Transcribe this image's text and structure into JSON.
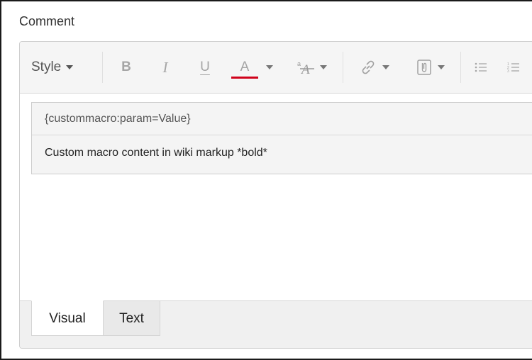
{
  "field": {
    "label": "Comment"
  },
  "toolbar": {
    "style_label": "Style",
    "bold_label": "B",
    "italic_label": "I",
    "underline_label": "U",
    "text_color_label": "A",
    "text_color_accent": "#d0021b",
    "icons": [
      "caret-down-icon",
      "text-size-icon",
      "link-icon",
      "attachment-icon",
      "bullet-list-icon",
      "numbered-list-icon"
    ]
  },
  "macro": {
    "header": "{custommacro:param=Value}",
    "body": "Custom macro content in wiki markup *bold*"
  },
  "tabs": [
    {
      "label": "Visual",
      "active": true
    },
    {
      "label": "Text",
      "active": false
    }
  ]
}
